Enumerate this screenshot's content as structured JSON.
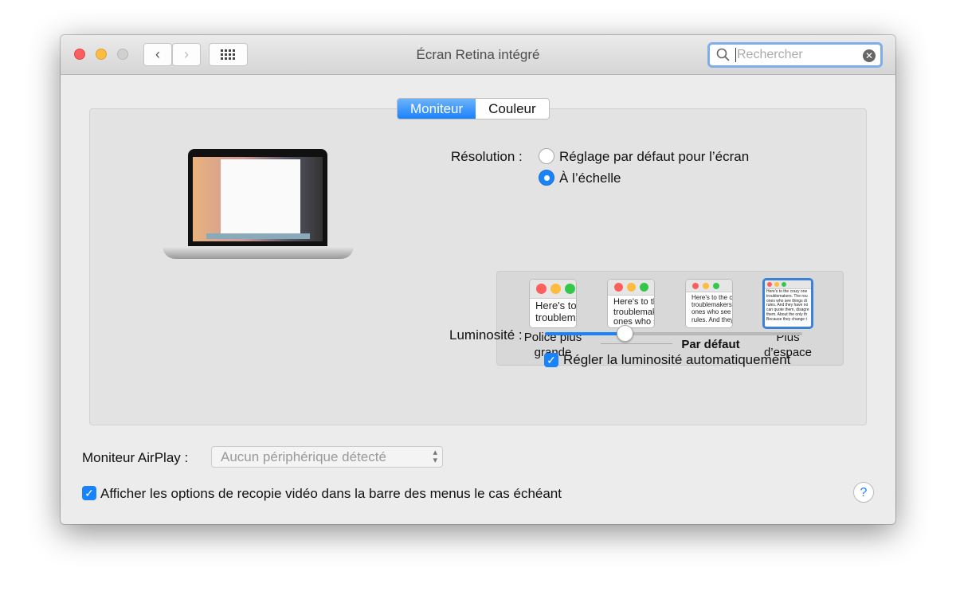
{
  "window": {
    "title": "Écran Retina intégré"
  },
  "search": {
    "placeholder": "Rechercher"
  },
  "tabs": [
    {
      "label": "Moniteur",
      "active": true
    },
    {
      "label": "Couleur",
      "active": false
    }
  ],
  "resolution": {
    "label": "Résolution :",
    "options": [
      {
        "label": "Réglage par défaut pour l’écran",
        "selected": false
      },
      {
        "label": "À l’échelle",
        "selected": true
      }
    ]
  },
  "scaling": [
    {
      "label": "Police plus grande",
      "sample": [
        "Here's to",
        "troublem"
      ]
    },
    {
      "label": "",
      "sample": [
        "Here's to th",
        "troublemak",
        "ones who s"
      ]
    },
    {
      "label": "Par défaut",
      "sample": [
        "Here's to the cr",
        "troublemakers.",
        "ones who see t",
        "rules. And they"
      ]
    },
    {
      "label": "Plus d’espace",
      "sample": [
        "Here's to the crazy one",
        "troublemakers. The rou",
        "ones who see things di",
        "rules. And they have no",
        "can quote them, disagre",
        "them. About the only th",
        "Because they change t"
      ],
      "selected": true
    }
  ],
  "brightness": {
    "label": "Luminosité :",
    "value": 0.31,
    "auto_label": "Régler la luminosité automatiquement",
    "auto_checked": true
  },
  "airplay": {
    "label": "Moniteur AirPlay :",
    "value": "Aucun périphérique détecté"
  },
  "mirror": {
    "label": "Afficher les options de recopie vidéo dans la barre des menus le cas échéant",
    "checked": true
  },
  "help": "?",
  "colors": {
    "accent": "#1a82fb"
  }
}
